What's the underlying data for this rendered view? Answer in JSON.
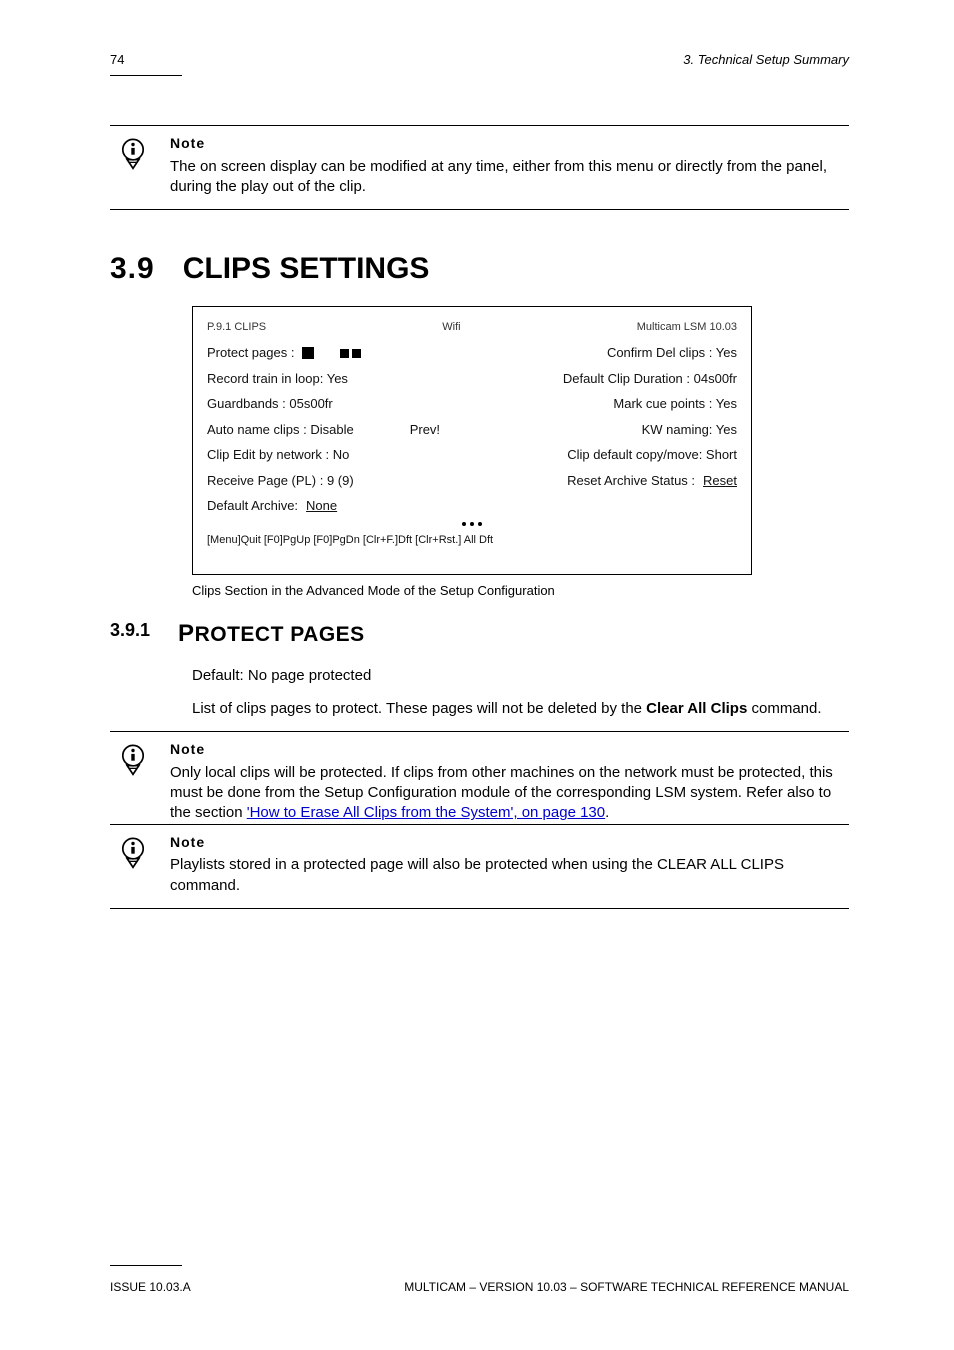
{
  "page_number_top": "74",
  "section_header": "3. Technical Setup Summary",
  "note1": {
    "label": "Note",
    "text": "The on screen display can be modified at any time, either from this menu or directly from the panel, during the play out of the clip."
  },
  "heading_3_9": {
    "num": "3.9",
    "title": "CLIPS SETTINGS"
  },
  "figure": {
    "title_left": "P.9.1 CLIPS",
    "wifi_label": "Wifi",
    "title_right": "Multicam LSM 10.03",
    "row1_left": "Protect pages :",
    "row1_mid_squares": true,
    "row1_right": "Confirm Del clips : Yes",
    "row2_left": "Record train in loop: Yes",
    "row2_right": "Default Clip Duration : 04s00fr",
    "row3_left": "Guardbands : 05s00fr",
    "row3_right": "Mark cue points : Yes",
    "row4_left": "Auto name clips : Disable",
    "row4_mid": "Prev!",
    "row4_right": "KW naming: Yes",
    "row5_left": "Clip Edit by network : No",
    "row5_right": "Clip default copy/move: Short",
    "row6_left": "Receive Page (PL) : 9 (9)",
    "row6_right": "Reset Archive Status : ",
    "row6_right_link": "Reset",
    "row7_left": "Default Archive: ",
    "row7_left_link": "None",
    "row_nav": "[Menu]Quit [F0]PgUp [F0]PgDn [Clr+F.]Dft [Clr+Rst.] All Dft"
  },
  "fig_caption": "Clips Section in the Advanced Mode of the Setup Configuration",
  "heading_3_9_1": {
    "num": "3.9.1",
    "title_first": "P",
    "title_rest": "ROTECT PAGES"
  },
  "para1": "Default: No page protected",
  "para2_part1": "List of clips pages to protect. These pages will not be deleted by the ",
  "para2_bold": "Clear All Clips",
  "para2_part2": " command.",
  "note2": {
    "label": "Note",
    "text_part1": "Only local clips will be protected. If clips from other machines on the network must be protected, this must be done from the Setup Configuration module of the corresponding LSM system. Refer also to the section ",
    "link1": "'How to Erase All Clips from the System', on page ",
    "link2": "130",
    "text_part2": "."
  },
  "note3": {
    "label": "Note",
    "text": "Playlists stored in a protected page will also be protected when using the CLEAR ALL CLIPS command."
  },
  "footer_left": "ISSUE 10.03.A",
  "footer_right": "MULTICAM – VERSION 10.03 – SOFTWARE TECHNICAL REFERENCE MANUAL"
}
